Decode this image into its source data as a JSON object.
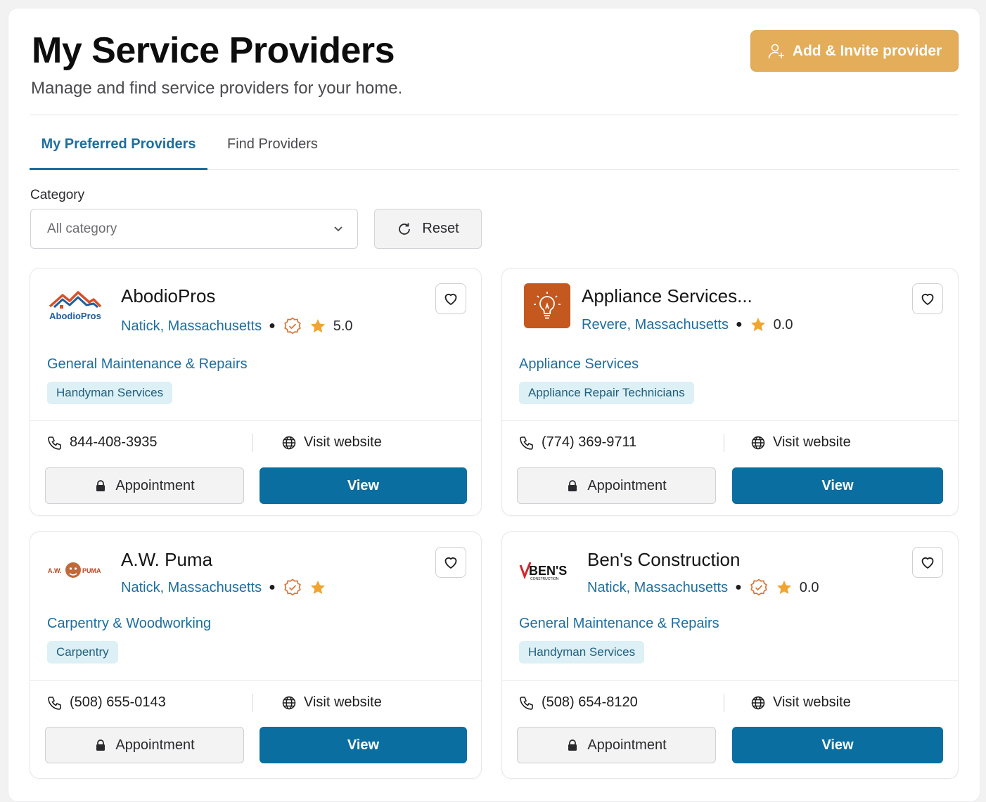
{
  "header": {
    "title": "My Service Providers",
    "subtitle": "Manage and find service providers for your home.",
    "add_button_label": "Add & Invite provider",
    "add_button_color": "#e3ad59"
  },
  "tabs": [
    {
      "label": "My Preferred Providers",
      "active": true
    },
    {
      "label": "Find Providers",
      "active": false
    }
  ],
  "filters": {
    "category_label": "Category",
    "category_value": "All category",
    "reset_label": "Reset"
  },
  "providers": [
    {
      "name": "AbodioPros",
      "logo_text": "AbodioPros",
      "location": "Natick, Massachusetts",
      "verified": true,
      "rating": "5.0",
      "category": "General Maintenance & Repairs",
      "tag": "Handyman Services",
      "phone": "844-408-3935",
      "website_label": "Visit website",
      "appointment_label": "Appointment",
      "view_label": "View"
    },
    {
      "name": "Appliance Services...",
      "logo_icon": "lightbulb-icon",
      "location": "Revere, Massachusetts",
      "verified": false,
      "rating": "0.0",
      "category": "Appliance Services",
      "tag": "Appliance Repair Technicians",
      "phone": "(774) 369-9711",
      "website_label": "Visit website",
      "appointment_label": "Appointment",
      "view_label": "View"
    },
    {
      "name": "A.W. Puma",
      "logo_text_left": "A.W.",
      "logo_text_right": "PUMA",
      "location": "Natick, Massachusetts",
      "verified": true,
      "rating": "",
      "category": "Carpentry & Woodworking",
      "tag": "Carpentry",
      "phone": "(508) 655-0143",
      "website_label": "Visit website",
      "appointment_label": "Appointment",
      "view_label": "View"
    },
    {
      "name": "Ben's Construction",
      "logo_text": "BEN'S",
      "logo_subtext": "CONSTRUCTION",
      "location": "Natick, Massachusetts",
      "verified": true,
      "rating": "0.0",
      "category": "General Maintenance & Repairs",
      "tag": "Handyman Services",
      "phone": "(508) 654-8120",
      "website_label": "Visit website",
      "appointment_label": "Appointment",
      "view_label": "View"
    }
  ],
  "colors": {
    "accent_blue": "#1e6e9e",
    "view_button": "#0a6ea0",
    "verified_badge": "#d5763a",
    "star": "#f0a530",
    "tag_bg": "#dcf0f5"
  }
}
